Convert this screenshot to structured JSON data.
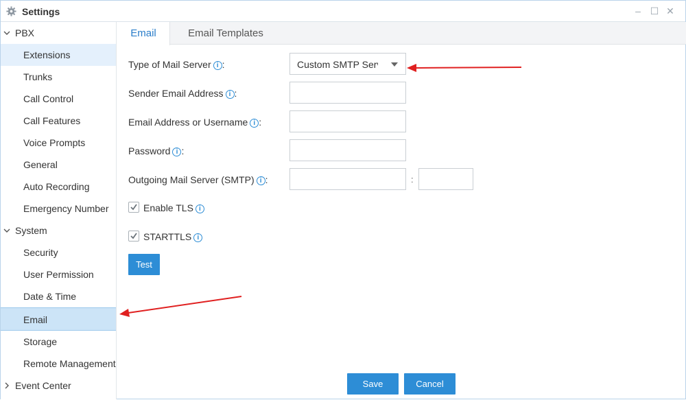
{
  "window": {
    "title": "Settings"
  },
  "window_controls": {
    "minimize": "–",
    "maximize": "☐",
    "close": "✕"
  },
  "sidebar": {
    "groups": [
      {
        "label": "PBX",
        "items": [
          "Extensions",
          "Trunks",
          "Call Control",
          "Call Features",
          "Voice Prompts",
          "General",
          "Auto Recording",
          "Emergency Number"
        ]
      },
      {
        "label": "System",
        "items": [
          "Security",
          "User Permission",
          "Date & Time",
          "Email",
          "Storage",
          "Remote Management"
        ]
      },
      {
        "label": "Event Center",
        "items": []
      }
    ],
    "selected_item": "Email"
  },
  "tabs": [
    {
      "label": "Email",
      "active": true
    },
    {
      "label": "Email Templates",
      "active": false
    }
  ],
  "form": {
    "mail_server_type": {
      "label": "Type of Mail Server",
      "value": "Custom SMTP Server"
    },
    "sender_email": {
      "label": "Sender Email Address",
      "value": ""
    },
    "email_or_username": {
      "label": "Email Address or Username",
      "value": ""
    },
    "password": {
      "label": "Password",
      "value": ""
    },
    "smtp": {
      "label": "Outgoing Mail Server (SMTP)",
      "server": "",
      "separator": ":",
      "port": ""
    },
    "enable_tls": {
      "label": "Enable TLS",
      "checked": true
    },
    "starttls": {
      "label": "STARTTLS",
      "checked": true
    },
    "label_suffix": ":",
    "info_glyph": "i",
    "test_button": "Test"
  },
  "footer": {
    "save": "Save",
    "cancel": "Cancel"
  },
  "colors": {
    "accent": "#2d8dd6",
    "selected_bg": "#cce4f7",
    "annotation_arrow": "#e02020"
  }
}
